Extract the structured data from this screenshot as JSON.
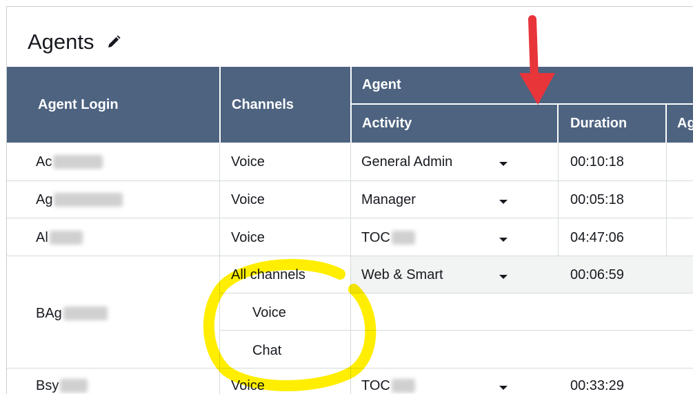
{
  "page": {
    "title": "Agents"
  },
  "table": {
    "headers": {
      "agent_login": "Agent Login",
      "channels": "Channels",
      "agent_group": "Agent",
      "activity": "Activity",
      "duration": "Duration",
      "next_col_partial": "Ag"
    },
    "rows": [
      {
        "login": "Ac",
        "channel": "Voice",
        "activity": "General Admin",
        "duration": "00:10:18"
      },
      {
        "login": "Ag",
        "channel": "Voice",
        "activity": "Manager",
        "duration": "00:05:18"
      },
      {
        "login": "Al",
        "channel": "Voice",
        "activity": "TOC",
        "duration": "04:47:06"
      },
      {
        "login": "BAg",
        "channel": "All channels",
        "activity": "Web & Smart",
        "duration": "00:06:59",
        "subchannels": [
          "Voice",
          "Chat"
        ]
      },
      {
        "login": "Bsy",
        "channel": "Voice",
        "activity": "TOC",
        "duration": "00:33:29"
      }
    ]
  },
  "annotations": {
    "arrow_color": "#e8353a",
    "highlight_color": "#ffee00"
  },
  "colors": {
    "header_bg": "#4d6380",
    "header_text": "#ffffff",
    "grid": "#d5dbdb"
  }
}
